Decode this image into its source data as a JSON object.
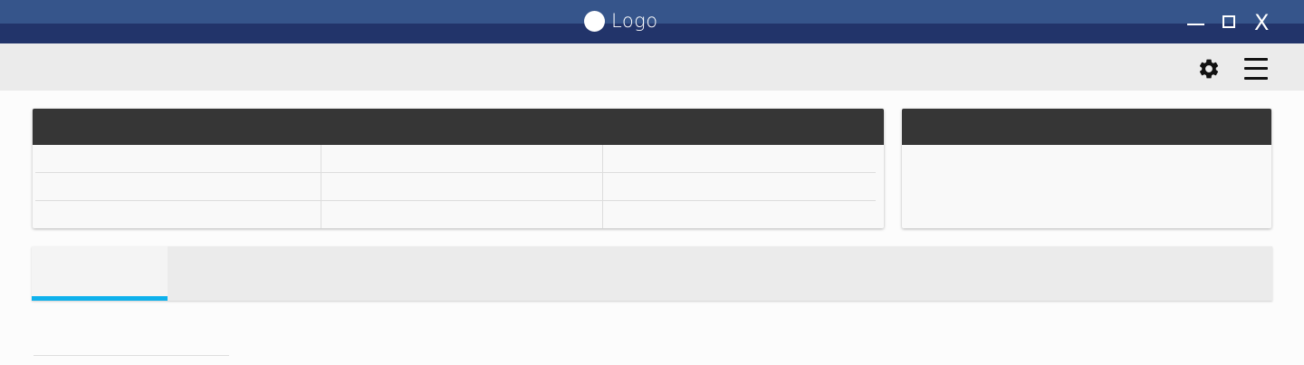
{
  "window": {
    "logo_text": "Logo",
    "logo_icon": "circle-icon",
    "controls": [
      "minimize-icon",
      "maximize-icon",
      "close-icon"
    ],
    "close_label": "X",
    "colors": {
      "titlebar_top": "#36558b",
      "titlebar_bottom": "#22346a"
    }
  },
  "toolbar": {
    "icons": [
      "gear-icon",
      "hamburger-menu-icon"
    ]
  },
  "main_card": {
    "title": "",
    "rows": [
      [
        "",
        "",
        ""
      ],
      [
        "",
        "",
        ""
      ],
      [
        "",
        "",
        ""
      ]
    ]
  },
  "side_card": {
    "title": ""
  },
  "tabs": {
    "items": [
      {
        "label": "",
        "selected": true
      }
    ],
    "colors": {
      "active_indicator": "#0eb1ec"
    }
  }
}
